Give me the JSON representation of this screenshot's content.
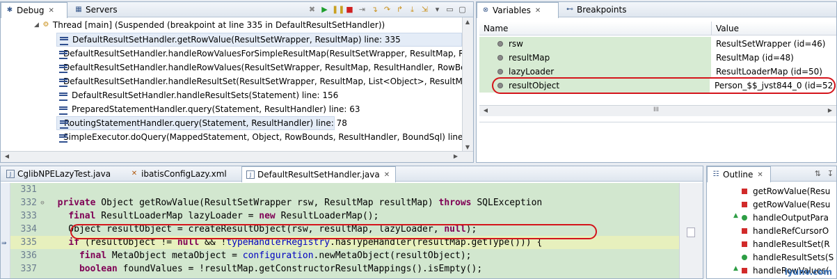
{
  "debug": {
    "tabs": [
      {
        "label": "Debug",
        "close": "✕"
      },
      {
        "label": "Servers"
      }
    ],
    "thread": "Thread [main] (Suspended (breakpoint at line 335 in DefaultResultSetHandler))",
    "frames": [
      "DefaultResultSetHandler.getRowValue(ResultSetWrapper, ResultMap) line: 335",
      "DefaultResultSetHandler.handleRowValuesForSimpleResultMap(ResultSetWrapper, ResultMap, R",
      "DefaultResultSetHandler.handleRowValues(ResultSetWrapper, ResultMap, ResultHandler, RowBo",
      "DefaultResultSetHandler.handleResultSet(ResultSetWrapper, ResultMap, List<Object>, ResultMa",
      "DefaultResultSetHandler.handleResultSets(Statement) line: 156",
      "PreparedStatementHandler.query(Statement, ResultHandler) line: 63",
      "RoutingStatementHandler.query(Statement, ResultHandler) line: 78",
      "SimpleExecutor.doQuery(MappedStatement, Object, RowBounds, ResultHandler, BoundSql) line:"
    ]
  },
  "variables": {
    "tabs": [
      {
        "label": "Variables",
        "close": "✕"
      },
      {
        "label": "Breakpoints"
      }
    ],
    "columns": {
      "name": "Name",
      "value": "Value"
    },
    "rows": [
      {
        "name": "rsw",
        "value": "ResultSetWrapper  (id=46)"
      },
      {
        "name": "resultMap",
        "value": "ResultMap  (id=48)"
      },
      {
        "name": "lazyLoader",
        "value": "ResultLoaderMap  (id=50)"
      },
      {
        "name": "resultObject",
        "value": "Person_$$_jvst844_0  (id=52)"
      }
    ],
    "scroll_grip": "III"
  },
  "editor": {
    "tabs": [
      {
        "label": "CglibNPELazyTest.java"
      },
      {
        "label": "ibatisConfigLazy.xml"
      },
      {
        "label": "DefaultResultSetHandler.java",
        "close": "✕"
      }
    ],
    "lines": [
      {
        "num": "331",
        "segs": [
          {
            "t": "",
            "c": ""
          }
        ]
      },
      {
        "num": "332",
        "segs": [
          {
            "t": "  ",
            "c": ""
          },
          {
            "t": "private",
            "c": "kw"
          },
          {
            "t": " Object getRowValue(ResultSetWrapper rsw, ResultMap resultMap) ",
            "c": ""
          },
          {
            "t": "throws",
            "c": "kw"
          },
          {
            "t": " SQLException",
            "c": ""
          }
        ]
      },
      {
        "num": "333",
        "segs": [
          {
            "t": "    ",
            "c": ""
          },
          {
            "t": "final",
            "c": "kw"
          },
          {
            "t": " ResultLoaderMap lazyLoader = ",
            "c": ""
          },
          {
            "t": "new",
            "c": "kw"
          },
          {
            "t": " ResultLoaderMap();",
            "c": ""
          }
        ]
      },
      {
        "num": "334",
        "segs": [
          {
            "t": "    Object resultObject = createResultObject(rsw, resultMap, lazyLoader, ",
            "c": ""
          },
          {
            "t": "null",
            "c": "kw"
          },
          {
            "t": ");",
            "c": ""
          }
        ]
      },
      {
        "num": "335",
        "segs": [
          {
            "t": "    ",
            "c": ""
          },
          {
            "t": "if",
            "c": "kw"
          },
          {
            "t": " (resultObject != ",
            "c": ""
          },
          {
            "t": "null",
            "c": "kw"
          },
          {
            "t": " && !",
            "c": ""
          },
          {
            "t": "typeHandlerRegistry",
            "c": "fld"
          },
          {
            "t": ".hasTypeHandler(resultMap.getType())) {",
            "c": ""
          }
        ]
      },
      {
        "num": "336",
        "segs": [
          {
            "t": "      ",
            "c": ""
          },
          {
            "t": "final",
            "c": "kw"
          },
          {
            "t": " MetaObject metaObject = ",
            "c": ""
          },
          {
            "t": "configuration",
            "c": "fld"
          },
          {
            "t": ".newMetaObject(resultObject);",
            "c": ""
          }
        ]
      },
      {
        "num": "337",
        "segs": [
          {
            "t": "      ",
            "c": ""
          },
          {
            "t": "boolean",
            "c": "kw"
          },
          {
            "t": " foundValues = !resultMap.getConstructorResultMappings().isEmpty();",
            "c": ""
          }
        ]
      }
    ]
  },
  "outline": {
    "tab": {
      "label": "Outline",
      "close": "✕"
    },
    "items": [
      {
        "label": "getRowValue(Resu",
        "icon": "sq"
      },
      {
        "label": "getRowValue(Resu",
        "icon": "sq"
      },
      {
        "label": "handleOutputPara",
        "icon": "cir"
      },
      {
        "label": "handleRefCursorO",
        "icon": "sq"
      },
      {
        "label": "handleResultSet(R",
        "icon": "sq"
      },
      {
        "label": "handleResultSets(S",
        "icon": "cir"
      },
      {
        "label": "handleRowValues(",
        "icon": "sq"
      }
    ],
    "watermark": "iyunv.com"
  }
}
